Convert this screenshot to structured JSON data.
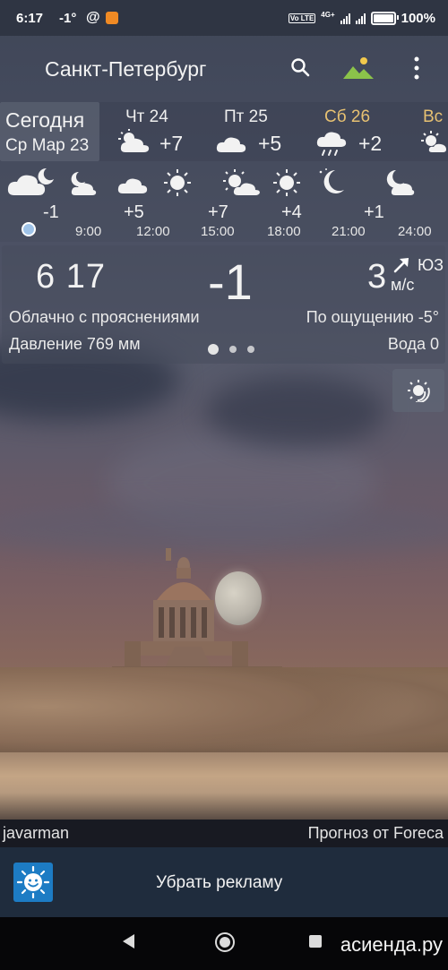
{
  "status_bar": {
    "time": "6:17",
    "temp": "-1°",
    "at_symbol": "@",
    "volte": "Vo LTE",
    "net": "4G+",
    "battery": "100%"
  },
  "app_bar": {
    "city": "Санкт-Петербург",
    "icons": [
      "search-icon",
      "landscape-photo-icon",
      "more-vert-icon"
    ],
    "accent_color": "#8bc34a"
  },
  "day_tabs": [
    {
      "line1": "Сегодня",
      "line2": "Ср Мар 23",
      "selected": true
    },
    {
      "name": "Чт 24",
      "temp": "+7",
      "icon": "partly-cloudy-icon"
    },
    {
      "name": "Пт 25",
      "temp": "+5",
      "icon": "cloud-icon"
    },
    {
      "name": "Сб 26",
      "temp": "+2",
      "icon": "rain-cloud-icon",
      "color": "#e7c172"
    },
    {
      "name": "Вс",
      "temp": "",
      "icon": "sun-cloud-icon"
    }
  ],
  "hourly": [
    {
      "temp": "-1",
      "time": "",
      "icon": "cloud-moon-icon"
    },
    {
      "temp": "+5",
      "time": "9:00",
      "icon": "cloud-icon"
    },
    {
      "temp": "+7",
      "time": "12:00",
      "icon": "sun-cloud-icon"
    },
    {
      "temp": "+4",
      "time": "15:00",
      "icon": "sun-icon"
    },
    {
      "temp": "+1",
      "time": "18:00",
      "icon": "moon-icon"
    },
    {
      "temp": "",
      "time": "21:00",
      "icon": "moon-cloud-icon"
    },
    {
      "temp": "",
      "time": "24:00",
      "icon": ""
    }
  ],
  "current": {
    "time": "6 17",
    "temp": "-1",
    "wind_speed": "3",
    "wind_dir": "ЮЗ",
    "wind_unit": "м/с",
    "condition": "Облачно с прояснениями",
    "feels_like": "По ощущению -5°",
    "pressure": "Давление 769 мм",
    "water": "Вода 0"
  },
  "credits": {
    "author": "javarman",
    "source": "Прогноз от Foreca"
  },
  "ad": {
    "label": "Убрать рекламу"
  },
  "watermark": "асиенда.ру"
}
